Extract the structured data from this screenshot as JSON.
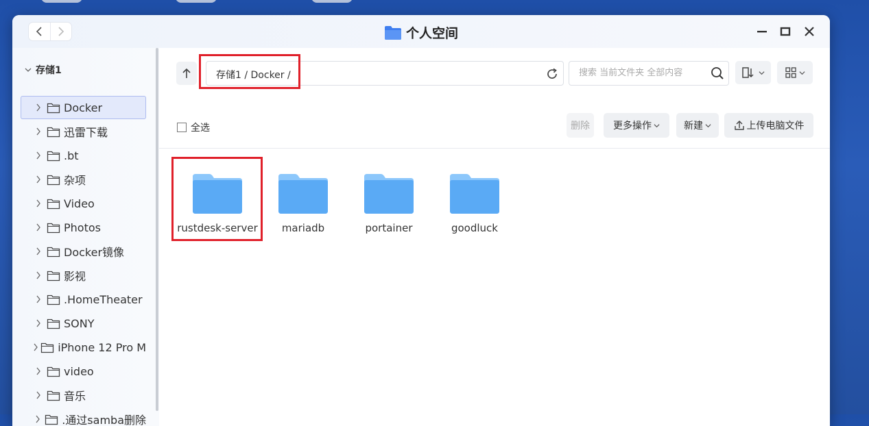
{
  "window": {
    "title": "个人空间"
  },
  "sidebar": {
    "root_label": "存储1",
    "items": [
      {
        "label": "Docker",
        "selected": true
      },
      {
        "label": "迅雷下载"
      },
      {
        "label": ".bt"
      },
      {
        "label": "杂项"
      },
      {
        "label": "Video"
      },
      {
        "label": "Photos"
      },
      {
        "label": "Docker镜像"
      },
      {
        "label": "影视"
      },
      {
        "label": ".HomeTheater"
      },
      {
        "label": "SONY"
      },
      {
        "label": "iPhone 12 Pro M"
      },
      {
        "label": "video"
      },
      {
        "label": "音乐"
      },
      {
        "label": ".通过samba删除"
      }
    ]
  },
  "toolbar": {
    "path": "存储1 / Docker /",
    "search_placeholder": "搜索 当前文件夹 全部内容",
    "select_all_label": "全选",
    "delete_label": "删除",
    "more_actions_label": "更多操作",
    "new_label": "新建",
    "upload_label": "上传电脑文件"
  },
  "folders": [
    {
      "name": "rustdesk-server"
    },
    {
      "name": "mariadb"
    },
    {
      "name": "portainer"
    },
    {
      "name": "goodluck"
    }
  ],
  "colors": {
    "accent": "#4a7cf0",
    "folder": "#5aaaf5",
    "highlight": "#e0202a",
    "selected_bg": "#e3e9fb"
  },
  "icons": [
    "back-icon",
    "forward-icon",
    "folder-icon",
    "minimize-icon",
    "maximize-icon",
    "close-icon",
    "chevron-right-icon",
    "chevron-down-icon",
    "up-arrow-icon",
    "refresh-icon",
    "search-icon",
    "sort-icon",
    "grid-view-icon",
    "upload-icon"
  ]
}
